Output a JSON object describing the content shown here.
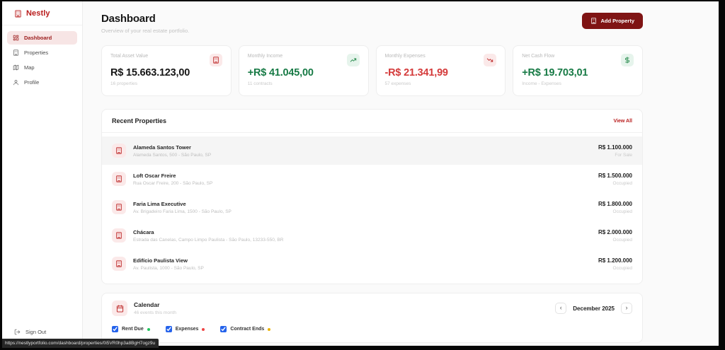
{
  "brand": {
    "name": "Nestly"
  },
  "sidebar": {
    "items": [
      {
        "label": "Dashboard"
      },
      {
        "label": "Properties"
      },
      {
        "label": "Map"
      },
      {
        "label": "Profile"
      }
    ],
    "sign_out": "Sign Out"
  },
  "header": {
    "title": "Dashboard",
    "subtitle": "Overview of your real estate portfolio.",
    "add_button": "Add Property"
  },
  "stats": [
    {
      "label": "Total Asset Value",
      "value": "R$ 15.663.123,00",
      "footnote": "16 properties",
      "icon": "building-icon"
    },
    {
      "label": "Monthly Income",
      "value": "+R$ 41.045,00",
      "footnote": "11 contracts",
      "icon": "trending-up-icon"
    },
    {
      "label": "Monthly Expenses",
      "value": "-R$ 21.341,99",
      "footnote": "57 expenses",
      "icon": "trending-down-icon"
    },
    {
      "label": "Net Cash Flow",
      "value": "+R$ 19.703,01",
      "footnote": "Income - Expenses",
      "icon": "dollar-icon"
    }
  ],
  "recent_properties": {
    "title": "Recent Properties",
    "view_all": "View All",
    "rows": [
      {
        "name": "Alameda Santos Tower",
        "address": "Alameda Santos, 500 - São Paulo, SP",
        "price": "R$ 1.100.000",
        "status": "For Sale"
      },
      {
        "name": "Loft Oscar Freire",
        "address": "Rua Oscar Freire, 200 - São Paulo, SP",
        "price": "R$ 1.500.000",
        "status": "Occupied"
      },
      {
        "name": "Faria Lima Executive",
        "address": "Av. Brigadeiro Faria Lima, 1500 - São Paulo, SP",
        "price": "R$ 1.800.000",
        "status": "Occupied"
      },
      {
        "name": "Chácara",
        "address": "Estrada das Canelas, Campo Limpo Paulista - São Paulo, 13233-550, BR",
        "price": "R$ 2.000.000",
        "status": "Occupied"
      },
      {
        "name": "Edifício Paulista View",
        "address": "Av. Paulista, 1000 - São Paulo, SP",
        "price": "R$ 1.200.000",
        "status": "Occupied"
      }
    ]
  },
  "calendar": {
    "title": "Calendar",
    "subtitle": "46 events this month",
    "month": "December 2025",
    "prev": "‹",
    "next": "›",
    "legend": [
      {
        "label": "Rent Due",
        "dot_color": "#22c55e"
      },
      {
        "label": "Expenses",
        "dot_color": "#ef4444"
      },
      {
        "label": "Contract Ends",
        "dot_color": "#eab308"
      }
    ]
  },
  "status_bar": {
    "url": "https://nestlyportfolio.com/dashboard/properties/0i5VR0hp3a8BgH7ogz9u"
  },
  "colors": {
    "brand_red": "#b91c1c",
    "button_red": "#7f1414",
    "positive_green": "#177a45",
    "negative_red": "#d43a3a"
  }
}
